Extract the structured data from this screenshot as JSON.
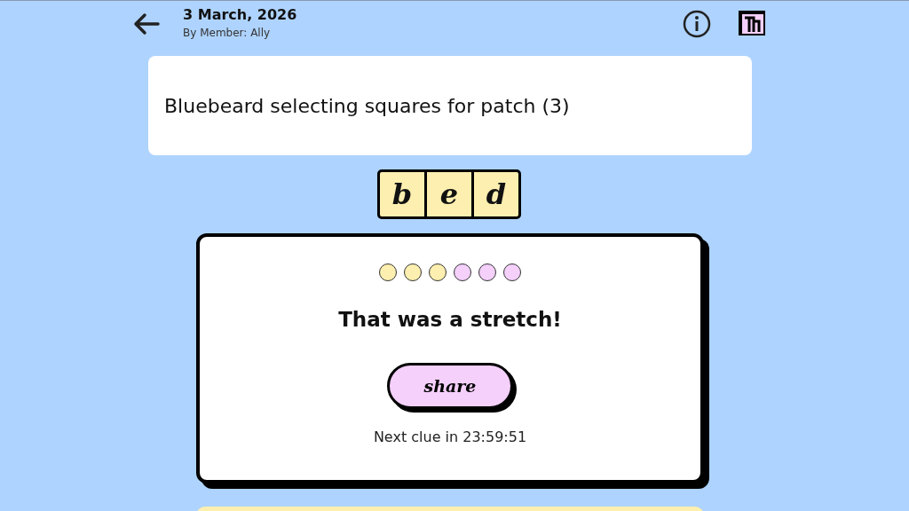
{
  "header": {
    "date": "3 March, 2026",
    "author": "By Member: Ally"
  },
  "clue": "Bluebeard selecting squares for patch (3)",
  "answer_tiles": [
    "b",
    "e",
    "d"
  ],
  "result": {
    "hints": [
      {
        "color": "#fdefaf"
      },
      {
        "color": "#fdefaf"
      },
      {
        "color": "#fdefaf"
      },
      {
        "color": "#f4d0fb"
      },
      {
        "color": "#f4d0fb"
      },
      {
        "color": "#f4d0fb"
      }
    ],
    "message": "That was a stretch!",
    "share_button": "share",
    "countdown": "Next clue in 23:59:51"
  }
}
